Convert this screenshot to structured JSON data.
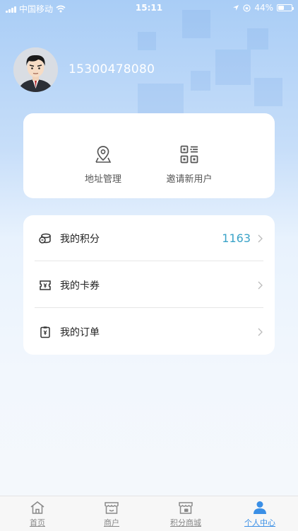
{
  "status_bar": {
    "carrier": "中国移动",
    "time": "15:11",
    "battery": "44%",
    "battery_level": 0.44,
    "icons": [
      "signal-icon",
      "wifi-icon",
      "location-arrow-icon",
      "orientation-lock-icon",
      "battery-icon"
    ]
  },
  "profile": {
    "phone": "15300478080",
    "avatar_icon": "user-avatar-icon"
  },
  "quick_actions": [
    {
      "label": "地址管理",
      "icon": "location-pin-icon"
    },
    {
      "label": "邀请新用户",
      "icon": "qr-code-icon"
    }
  ],
  "menu": [
    {
      "label": "我的积分",
      "value": "1163",
      "icon": "coins-icon"
    },
    {
      "label": "我的卡券",
      "value": "",
      "icon": "coupon-icon"
    },
    {
      "label": "我的订单",
      "value": "",
      "icon": "order-clipboard-icon"
    }
  ],
  "tabs": [
    {
      "label": "首页",
      "icon": "home-icon",
      "active": false
    },
    {
      "label": "商户",
      "icon": "store-icon",
      "active": false
    },
    {
      "label": "积分商城",
      "icon": "points-mall-icon",
      "active": false
    },
    {
      "label": "个人中心",
      "icon": "user-icon",
      "active": true
    }
  ],
  "colors": {
    "accent": "#3a8fe6",
    "points_value": "#3aa3c8",
    "header_gradient_top": "#a9cdf6",
    "background": "#f5f8fc"
  }
}
